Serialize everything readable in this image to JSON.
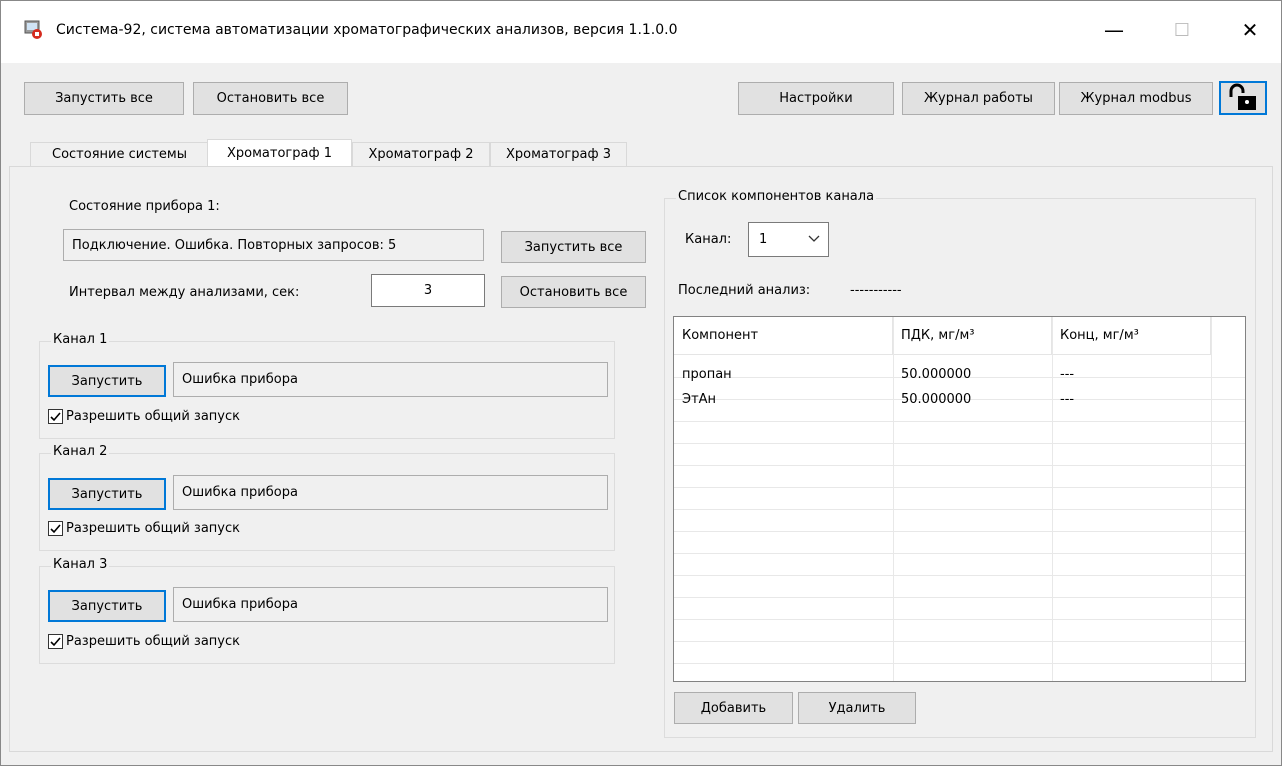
{
  "window": {
    "title": "Система-92, система автоматизации хроматографических анализов, версия 1.1.0.0",
    "minimize_glyph": "—",
    "maximize_glyph": "☐",
    "close_glyph": "✕"
  },
  "toolbar": {
    "start_all": "Запустить все",
    "stop_all": "Остановить все",
    "settings": "Настройки",
    "work_log": "Журнал работы",
    "modbus_log": "Журнал modbus",
    "lock_icon": "unlocked-padlock-icon"
  },
  "tabs": [
    {
      "label": "Состояние системы",
      "active": false
    },
    {
      "label": "Хроматограф 1",
      "active": true
    },
    {
      "label": "Хроматограф 2",
      "active": false
    },
    {
      "label": "Хроматограф 3",
      "active": false
    }
  ],
  "device": {
    "state_label": "Состояние прибора 1:",
    "state_value": "Подключение. Ошибка. Повторных запросов: 5",
    "start_all": "Запустить все",
    "interval_label": "Интервал между анализами, сек:",
    "interval_value": "3",
    "stop_all": "Остановить все"
  },
  "channels": [
    {
      "title": "Канал 1",
      "run": "Запустить",
      "status": "Ошибка прибора",
      "allow": "Разрешить общий запуск",
      "checked": true
    },
    {
      "title": "Канал 2",
      "run": "Запустить",
      "status": "Ошибка прибора",
      "allow": "Разрешить общий запуск",
      "checked": true
    },
    {
      "title": "Канал 3",
      "run": "Запустить",
      "status": "Ошибка прибора",
      "allow": "Разрешить общий запуск",
      "checked": true
    }
  ],
  "components": {
    "title": "Список компонентов канала",
    "channel_label": "Канал:",
    "channel_value": "1",
    "last_analysis_label": "Последний анализ:",
    "last_analysis_value": "-----------",
    "columns": [
      "Компонент",
      "ПДК, мг/м³",
      "Конц, мг/м³"
    ],
    "rows": [
      [
        "пропан",
        "50.000000",
        "---"
      ],
      [
        "ЭтАн",
        "50.000000",
        "---"
      ]
    ],
    "add": "Добавить",
    "delete": "Удалить"
  },
  "colors": {
    "accent": "#0078d7",
    "window_bg": "#f0f0f0"
  }
}
